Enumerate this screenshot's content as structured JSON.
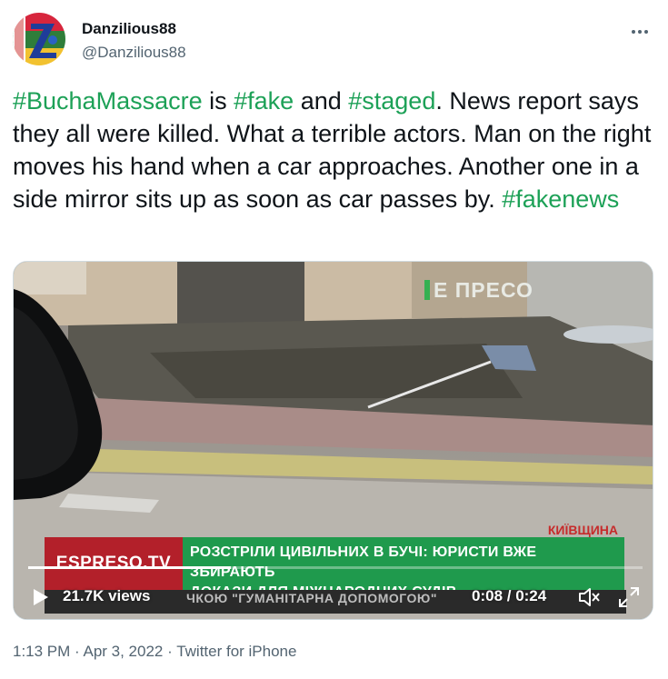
{
  "user": {
    "display_name": "Danzilious88",
    "handle": "@Danzilious88"
  },
  "tweet": {
    "segments": [
      {
        "text": "#BuchaMassacre",
        "hashtag": true
      },
      {
        "text": " is ",
        "hashtag": false
      },
      {
        "text": "#fake",
        "hashtag": true
      },
      {
        "text": " and ",
        "hashtag": false
      },
      {
        "text": "#staged",
        "hashtag": true
      },
      {
        "text": ". News report says they all were killed.  What a terrible actors. Man on the right moves his hand when a car approaches. Another one in a side mirror sits up as soon as car passes by. ",
        "hashtag": false
      },
      {
        "text": "#fakenews",
        "hashtag": true
      }
    ]
  },
  "video": {
    "channel_logo": "ПРЕСО",
    "channel_logo_prefix": "E",
    "region_label": "КИЇВЩИНА",
    "chyron_brand": "ESPRESO.TV",
    "chyron_line1": "РОЗСТРІЛИ ЦИВІЛЬНИХ В БУЧІ: ЮРИСТИ ВЖЕ ЗБИРАЮТЬ",
    "chyron_line2": "ДОКАЗИ ДЛЯ МІЖНАРОДНИХ СУДІВ",
    "ticker": "ЧКОЮ \"ГУМАНІТАРНА ДОПОМОГОЮ\"",
    "views": "21.7K views",
    "current_time": "0:08",
    "duration": "0:24",
    "time_display": "0:08 / 0:24",
    "progress_fraction": 0.33,
    "icons": {
      "play": "play-icon",
      "mute": "mute-icon",
      "fullscreen": "fullscreen-icon",
      "more": "more-icon"
    }
  },
  "meta": {
    "timestamp": "1:13 PM · Apr 3, 2022 · ",
    "source": "Twitter for iPhone"
  },
  "colors": {
    "hashtag": "#1da157",
    "secondary_text": "#536471",
    "chyron_red": "#b3202a",
    "chyron_green": "#1f9a4d"
  }
}
